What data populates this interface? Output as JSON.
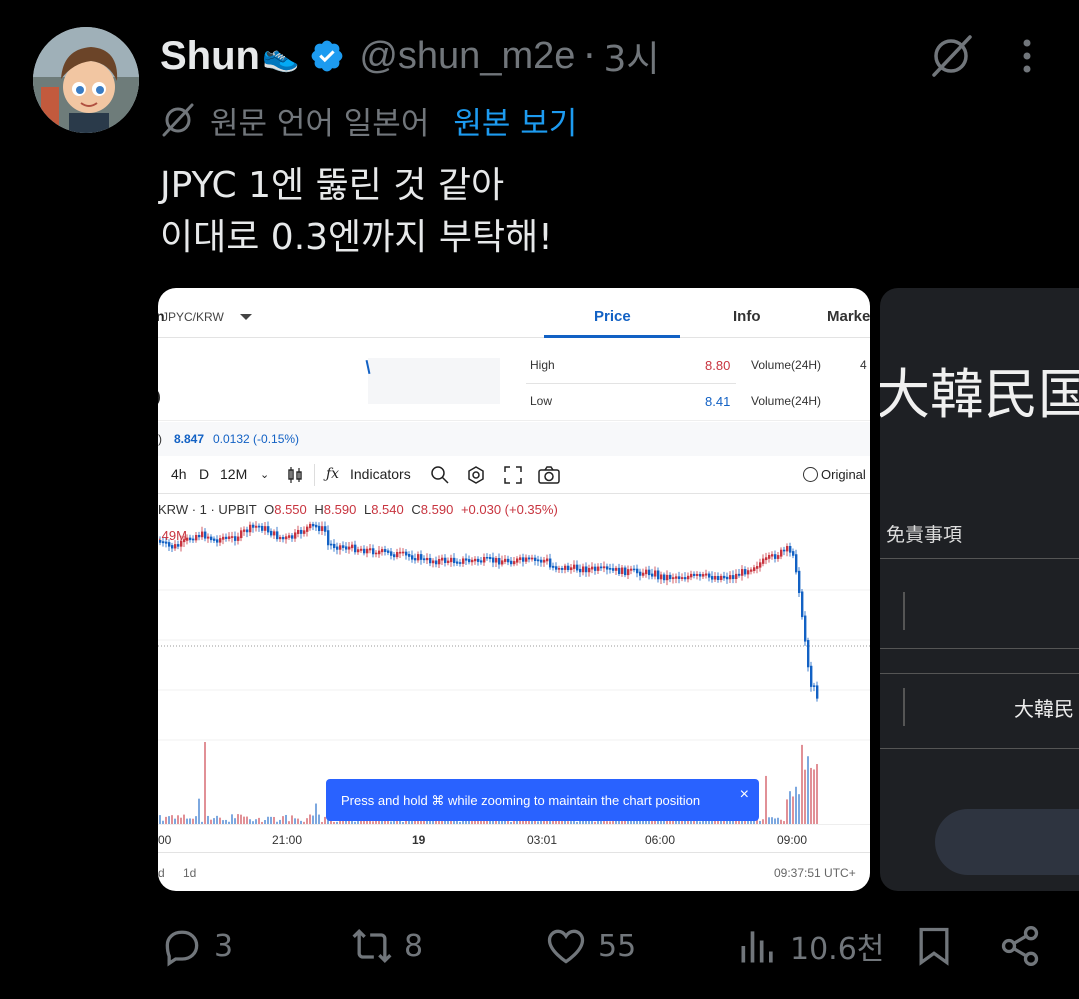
{
  "tweet": {
    "display_name": "Shun",
    "name_emoji": "👟",
    "handle": "@shun_m2e",
    "separator": "·",
    "time": "3시",
    "translate_lang": "원문 언어 일본어",
    "translate_link": "원본 보기",
    "text_line1": "JPYC 1엔 뚫린 것 같아",
    "text_line2": "이대로 0.3엔까지 부탁해!"
  },
  "media1": {
    "pair": "JPYC/KRW",
    "pair_prefix": "n",
    "tabs": [
      "Price",
      "Info",
      "Marke"
    ],
    "active_tab": "Price",
    "high_label": "High",
    "high_value": "8.80",
    "low_label": "Low",
    "low_value": "8.41",
    "volume_label_1": "Volume(24H)",
    "volume_label_2": "Volume(24H)",
    "volume_value_1": "4",
    "price_prefix": ")",
    "current_price": "8.847",
    "price_change": "0.0132 (-0.15%)",
    "toolbar": {
      "interval": "4h",
      "d": "D",
      "range": "12M",
      "indicators": "Indicators",
      "original": "Original"
    },
    "ohlc": {
      "prefix": "KRW · 1 · UPBIT",
      "o_label": "O",
      "o": "8.550",
      "h_label": "H",
      "h": "8.590",
      "l_label": "L",
      "l": "8.540",
      "c_label": "C",
      "c": "8.590",
      "change": "+0.030 (+0.35%)"
    },
    "volume_value": ".49M",
    "toast": "Press and hold ⌘ while zooming to maintain the chart position",
    "toast_close": "×",
    "xaxis": [
      "00",
      "21:00",
      "19",
      "03:01",
      "06:00",
      "09:00"
    ],
    "bottom_left_1": "d",
    "bottom_left_2": "1d",
    "timestamp": "09:37:51 UTC+"
  },
  "media2": {
    "title": "大韓民国",
    "subtitle": "免責事項",
    "cell": "大韓民"
  },
  "actions": {
    "replies": "3",
    "retweets": "8",
    "likes": "55",
    "views": "10.6천"
  },
  "colors": {
    "accent": "#1d9bf0",
    "muted": "#71767b",
    "up": "#c8343f",
    "down": "#1261c4"
  }
}
